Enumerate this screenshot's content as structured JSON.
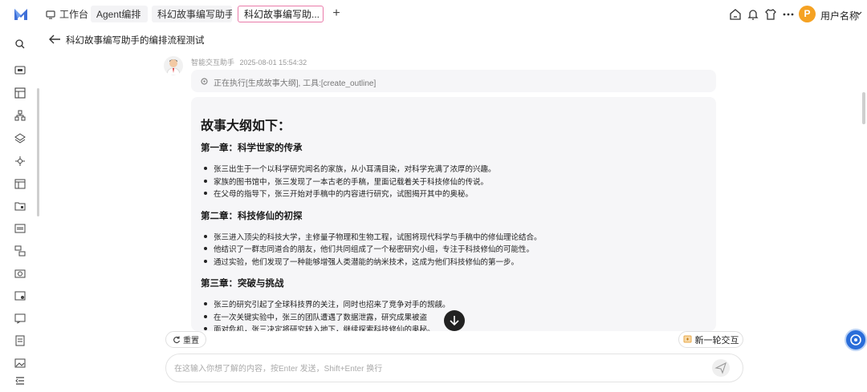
{
  "topbar": {
    "tabs": [
      {
        "label": "工作台"
      },
      {
        "label": "Agent编排"
      },
      {
        "label": "科幻故事编写助手"
      },
      {
        "label": "科幻故事编写助..."
      }
    ],
    "user": {
      "avatar_letter": "P",
      "name": "用户名称"
    }
  },
  "page": {
    "title": "科幻故事编写助手的编排流程测试"
  },
  "message": {
    "sender": "智能交互助手",
    "timestamp": "2025-08-01 15:54:32",
    "exec_status": "正在执行[生成故事大纲], 工具:[create_outline]",
    "content_title": "故事大纲如下：",
    "chapters": [
      {
        "title": "第一章：科学世家的传承",
        "bullets": [
          "张三出生于一个以科学研究闻名的家族，从小耳濡目染，对科学充满了浓厚的兴趣。",
          "家族的图书馆中，张三发现了一本古老的手稿，里面记载着关于科技修仙的传说。",
          "在父母的指导下，张三开始对手稿中的内容进行研究，试图揭开其中的奥秘。"
        ]
      },
      {
        "title": "第二章：科技修仙的初探",
        "bullets": [
          "张三进入顶尖的科技大学，主修量子物理和生物工程，试图将现代科学与手稿中的修仙理论结合。",
          "他结识了一群志同道合的朋友，他们共同组成了一个秘密研究小组，专注于科技修仙的可能性。",
          "通过实验，他们发现了一种能够增强人类潜能的纳米技术，这成为他们科技修仙的第一步。"
        ]
      },
      {
        "title": "第三章：突破与挑战",
        "bullets": [
          "张三的研究引起了全球科技界的关注，同时也招来了竞争对手的觊觎。",
          "在一次关键实验中，张三的团队遭遇了数据泄露，研究成果被盗",
          "面对危机，张三决定将研究转入地下，继续探索科技修仙的奥秘。"
        ]
      }
    ]
  },
  "actions": {
    "reset_label": "重置",
    "new_label": "新一轮交互"
  },
  "input": {
    "placeholder": "在这输入你想了解的内容，按Enter 发送，Shift+Enter 换行"
  },
  "colors": {
    "accent": "#e97ba9",
    "brand_blue": "#2a6dd9",
    "avatar_orange": "#f5a223"
  }
}
